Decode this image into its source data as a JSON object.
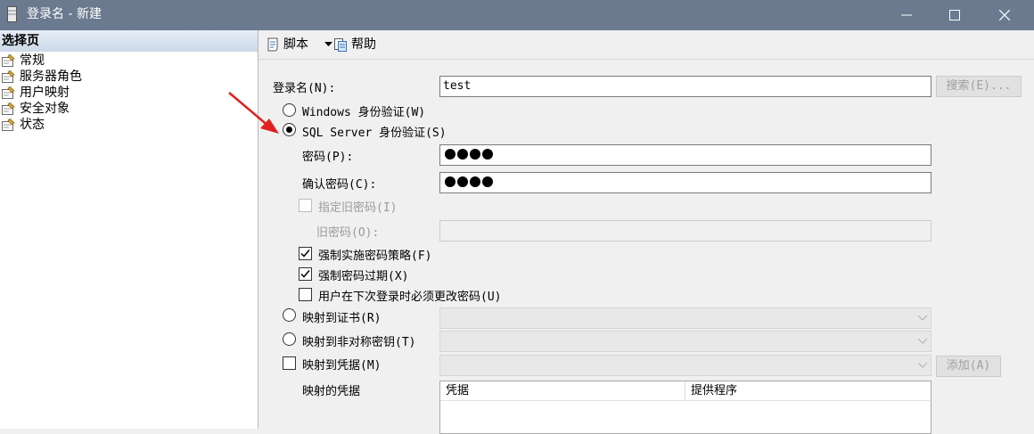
{
  "window": {
    "title": "登录名 - 新建"
  },
  "sidebar": {
    "header": "选择页",
    "items": [
      {
        "label": "常规"
      },
      {
        "label": "服务器角色"
      },
      {
        "label": "用户映射"
      },
      {
        "label": "安全对象"
      },
      {
        "label": "状态"
      }
    ]
  },
  "toolbar": {
    "script_label": "脚本",
    "help_label": "帮助"
  },
  "form": {
    "login_label": "登录名(N):",
    "login_value": "test",
    "search_button": "搜索(E)...",
    "windows_auth": "Windows 身份验证(W)",
    "windows_auth_selected": false,
    "sql_auth": "SQL Server 身份验证(S)",
    "sql_auth_selected": true,
    "password_label": "密码(P):",
    "confirm_password_label": "确认密码(C):",
    "password_mask_count": 4,
    "specify_old_password": "指定旧密码(I)",
    "specify_old_password_checked": false,
    "old_password_label": "旧密码(O):",
    "enforce_policy": "强制实施密码策略(F)",
    "enforce_policy_checked": true,
    "enforce_expiration": "强制密码过期(X)",
    "enforce_expiration_checked": true,
    "must_change": "用户在下次登录时必须更改密码(U)",
    "must_change_checked": false,
    "map_certificate": "映射到证书(R)",
    "map_asymmetric_key": "映射到非对称密钥(T)",
    "map_credential": "映射到凭据(M)",
    "map_credential_checked": false,
    "add_button": "添加(A)",
    "mapped_credentials_label": "映射的凭据",
    "grid_columns": [
      "凭据",
      "提供程序"
    ]
  },
  "colors": {
    "titlebar": "#6b7a8f",
    "arrow": "#e02020"
  }
}
